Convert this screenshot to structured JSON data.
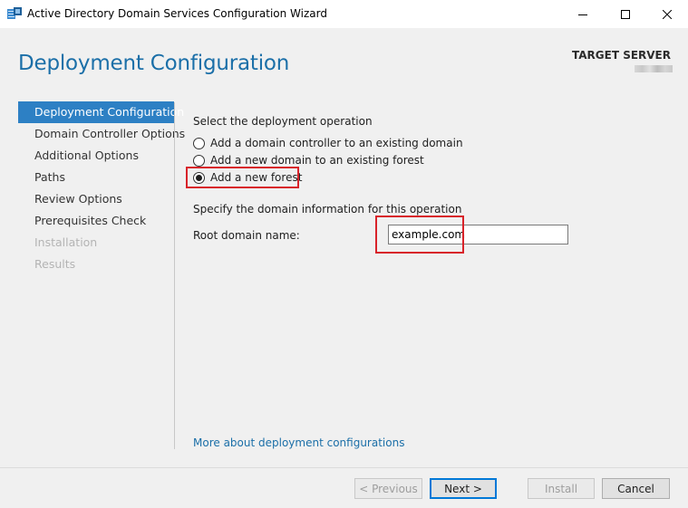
{
  "window": {
    "title": "Active Directory Domain Services Configuration Wizard",
    "icon": "server-wizard-icon",
    "controls": [
      "minimize-icon",
      "maximize-icon",
      "close-icon"
    ]
  },
  "header": {
    "page_title": "Deployment Configuration",
    "target_label": "TARGET SERVER"
  },
  "nav": {
    "items": [
      {
        "label": "Deployment Configuration",
        "state": "active"
      },
      {
        "label": "Domain Controller Options",
        "state": "enabled"
      },
      {
        "label": "Additional Options",
        "state": "enabled"
      },
      {
        "label": "Paths",
        "state": "enabled"
      },
      {
        "label": "Review Options",
        "state": "enabled"
      },
      {
        "label": "Prerequisites Check",
        "state": "enabled"
      },
      {
        "label": "Installation",
        "state": "disabled"
      },
      {
        "label": "Results",
        "state": "disabled"
      }
    ]
  },
  "main": {
    "operation_heading": "Select the deployment operation",
    "options": [
      {
        "label": "Add a domain controller to an existing domain",
        "selected": false
      },
      {
        "label": "Add a new domain to an existing forest",
        "selected": false
      },
      {
        "label": "Add a new forest",
        "selected": true
      }
    ],
    "domain_heading": "Specify the domain information for this operation",
    "root_domain_label": "Root domain name:",
    "root_domain_value": "example.com",
    "more_link": "More about deployment configurations"
  },
  "footer": {
    "previous_label": "< Previous",
    "next_label": "Next >",
    "install_label": "Install",
    "cancel_label": "Cancel"
  },
  "colors": {
    "accent": "#2d80c4",
    "title_blue": "#1b6fa8",
    "highlight_red": "#d8232a"
  }
}
